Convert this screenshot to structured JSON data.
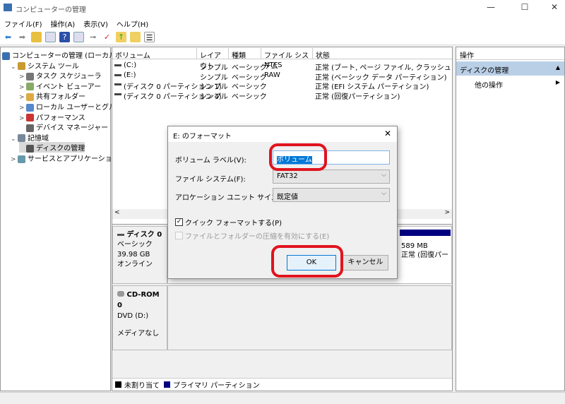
{
  "window": {
    "title": "コンピューターの管理",
    "minimize": "—",
    "maximize": "☐",
    "close": "✕"
  },
  "menu": [
    "ファイル(F)",
    "操作(A)",
    "表示(V)",
    "ヘルプ(H)"
  ],
  "tree": [
    {
      "label": "コンピューターの管理 (ローカル)",
      "level": 0,
      "arrow": ""
    },
    {
      "label": "システム ツール",
      "level": 1,
      "arrow": "⌄"
    },
    {
      "label": "タスク スケジューラ",
      "level": 2,
      "arrow": ">"
    },
    {
      "label": "イベント ビューアー",
      "level": 2,
      "arrow": ">"
    },
    {
      "label": "共有フォルダー",
      "level": 2,
      "arrow": ">"
    },
    {
      "label": "ローカル ユーザーとグループ",
      "level": 2,
      "arrow": ">"
    },
    {
      "label": "パフォーマンス",
      "level": 2,
      "arrow": ">"
    },
    {
      "label": "デバイス マネージャー",
      "level": 2,
      "arrow": ""
    },
    {
      "label": "記憶域",
      "level": 1,
      "arrow": "⌄"
    },
    {
      "label": "ディスクの管理",
      "level": 2,
      "arrow": "",
      "selected": true
    },
    {
      "label": "サービスとアプリケーション",
      "level": 1,
      "arrow": ">"
    }
  ],
  "volumes": {
    "headers": [
      "ボリューム",
      "レイアウト",
      "種類",
      "ファイル システム",
      "状態"
    ],
    "rows": [
      [
        "(C:)",
        "シンプル",
        "ベーシック",
        "NTFS",
        "正常 (ブート, ページ ファイル, クラッシュ ダンプ, ベーシ"
      ],
      [
        "(E:)",
        "シンプル",
        "ベーシック",
        "RAW",
        "正常 (ベーシック データ パーティション)"
      ],
      [
        "(ディスク 0 パーティション 1)",
        "シンプル",
        "ベーシック",
        "",
        "正常 (EFI システム パーティション)"
      ],
      [
        "(ディスク 0 パーティション 4)",
        "シンプル",
        "ベーシック",
        "",
        "正常 (回復パーティション)"
      ]
    ]
  },
  "disks": [
    {
      "name": "ディスク 0",
      "type": "ベーシック",
      "size": "39.98 GB",
      "status": "オンライン",
      "partition_size": "589 MB",
      "partition_status": "正常 (回復パーティ"
    },
    {
      "name": "CD-ROM 0",
      "type": "DVD (D:)",
      "size": "",
      "status": "メディアなし"
    }
  ],
  "legend": [
    {
      "label": "未割り当て",
      "color": "#000000"
    },
    {
      "label": "プライマリ パーティション",
      "color": "#000080"
    }
  ],
  "actions": {
    "header": "操作",
    "section": "ディスクの管理",
    "item": "他の操作"
  },
  "dialog": {
    "title": "E: のフォーマット",
    "volume_label_label": "ボリューム ラベル(V):",
    "volume_label_value": "ボリューム",
    "fs_label": "ファイル システム(F):",
    "fs_value": "FAT32",
    "alloc_label": "アロケーション ユニット サイズ(A):",
    "alloc_value": "既定値",
    "quick_format": "クイック フォーマットする(P)",
    "quick_format_checked": true,
    "compression": "ファイルとフォルダーの圧縮を有効にする(E)",
    "compression_checked": false,
    "ok": "OK",
    "cancel": "キャンセル",
    "close": "✕"
  },
  "colors": {
    "highlight": "#e0141e",
    "primary": "#000080",
    "selection": "#cce8ff"
  }
}
